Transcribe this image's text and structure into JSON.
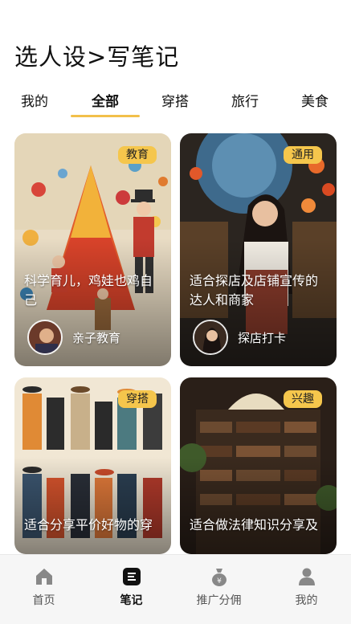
{
  "header": {
    "title": "选人设>写笔记"
  },
  "tabs": [
    {
      "label": "我的"
    },
    {
      "label": "全部"
    },
    {
      "label": "穿搭"
    },
    {
      "label": "旅行"
    },
    {
      "label": "美食"
    }
  ],
  "active_tab": "全部",
  "cards": [
    {
      "badge": "教育",
      "desc": "科学育儿，鸡娃也鸡自己",
      "tag": "亲子教育"
    },
    {
      "badge": "通用",
      "desc": "适合探店及店铺宣传的达人和商家",
      "tag": "探店打卡"
    },
    {
      "badge": "穿搭",
      "desc": "适合分享平价好物的穿"
    },
    {
      "badge": "兴趣",
      "desc": "适合做法律知识分享及"
    }
  ],
  "bottom_nav": [
    {
      "label": "首页",
      "icon": "home-icon"
    },
    {
      "label": "笔记",
      "icon": "notes-icon"
    },
    {
      "label": "推广分佣",
      "icon": "money-bag-icon"
    },
    {
      "label": "我的",
      "icon": "profile-icon"
    }
  ],
  "colors": {
    "accent": "#f5c64c",
    "underline": "#f2c04a"
  }
}
